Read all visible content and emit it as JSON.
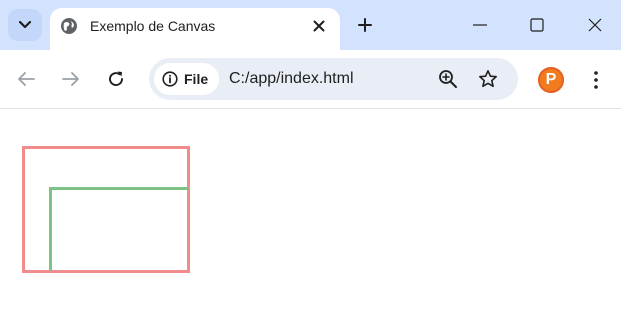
{
  "browser": {
    "tab": {
      "title": "Exemplo de Canvas",
      "favicon": "globe-icon"
    },
    "toolbar": {
      "site_chip_label": "File",
      "url": "C:/app/index.html",
      "profile_initial": "P"
    },
    "icons": {
      "tab_search": "chevron-down-icon",
      "tab_close": "close-icon",
      "new_tab": "plus-icon",
      "minimize": "minimize-icon",
      "maximize": "maximize-icon",
      "window_close": "close-icon",
      "back": "arrow-left-icon",
      "forward": "arrow-right-icon",
      "reload": "reload-icon",
      "site_info": "info-icon",
      "zoom": "zoom-in-icon",
      "bookmark": "star-icon",
      "menu": "kebab-menu-icon"
    }
  },
  "page": {
    "canvas_shapes": [
      {
        "kind": "rectangle-outline",
        "color": "#f28b8b"
      },
      {
        "kind": "corner-lines",
        "color": "#7dc383"
      }
    ]
  },
  "colors": {
    "tabstrip_bg": "#d3e3fd",
    "omnibox_bg": "#e9eef6",
    "profile_bg": "#f07c1e"
  }
}
